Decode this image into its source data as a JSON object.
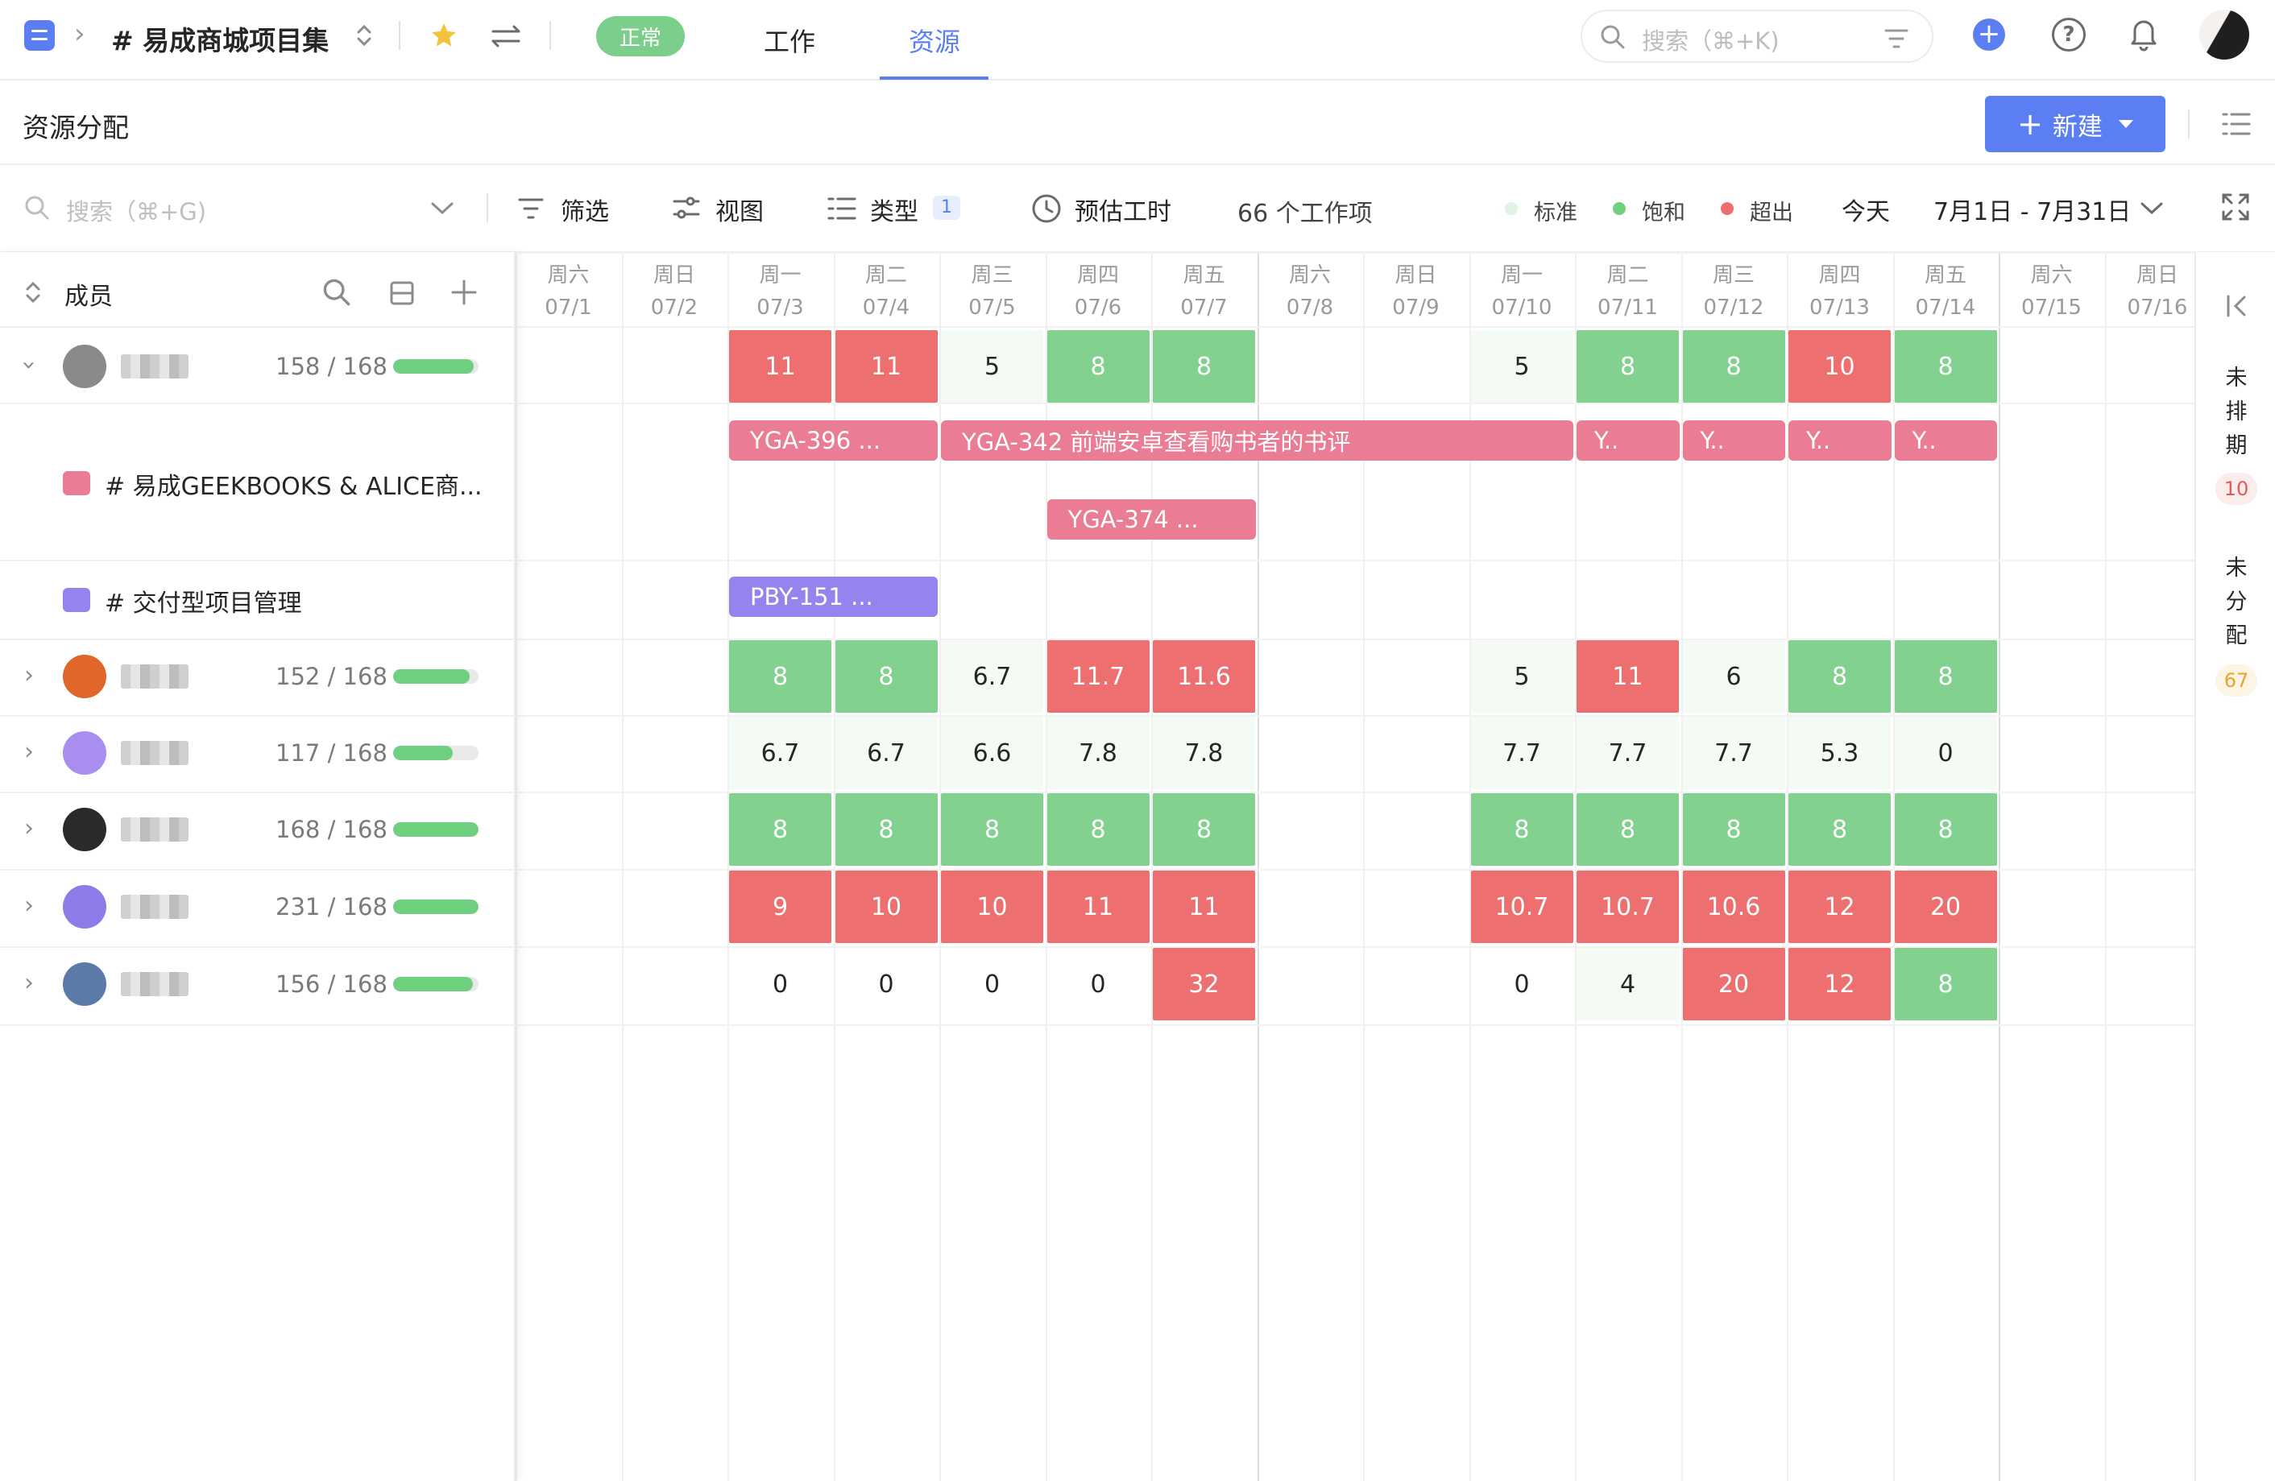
{
  "topbar": {
    "project_title": "# 易成商城项目集",
    "status_pill": "正常",
    "tabs": [
      {
        "label": "工作",
        "active": false
      },
      {
        "label": "资源",
        "active": true
      }
    ],
    "search_placeholder": "搜索（⌘+K)"
  },
  "header": {
    "title": "资源分配",
    "new_button": "新建"
  },
  "toolbar": {
    "search_placeholder": "搜索（⌘+G)",
    "filter_label": "筛选",
    "view_label": "视图",
    "type_label": "类型",
    "type_count": "1",
    "estimate_label": "预估工时",
    "items_count": "66 个工作项",
    "legend": [
      {
        "label": "标准",
        "color": "#e6f6e8"
      },
      {
        "label": "饱和",
        "color": "#6fd080"
      },
      {
        "label": "超出",
        "color": "#ed6f6f"
      }
    ],
    "today_label": "今天",
    "date_range": "7月1日 - 7月31日"
  },
  "left_panel": {
    "column_title": "成员"
  },
  "days": [
    {
      "weekday": "周六",
      "date": "07/1"
    },
    {
      "weekday": "周日",
      "date": "07/2"
    },
    {
      "weekday": "周一",
      "date": "07/3"
    },
    {
      "weekday": "周二",
      "date": "07/4"
    },
    {
      "weekday": "周三",
      "date": "07/5"
    },
    {
      "weekday": "周四",
      "date": "07/6"
    },
    {
      "weekday": "周五",
      "date": "07/7"
    },
    {
      "weekday": "周六",
      "date": "07/8"
    },
    {
      "weekday": "周日",
      "date": "07/9"
    },
    {
      "weekday": "周一",
      "date": "07/10"
    },
    {
      "weekday": "周二",
      "date": "07/11"
    },
    {
      "weekday": "周三",
      "date": "07/12"
    },
    {
      "weekday": "周四",
      "date": "07/13"
    },
    {
      "weekday": "周五",
      "date": "07/14"
    },
    {
      "weekday": "周六",
      "date": "07/15"
    },
    {
      "weekday": "周日",
      "date": "07/16"
    }
  ],
  "members": [
    {
      "hours": "158 / 168",
      "usage": 0.94,
      "avatar_color": "#8a8a8a",
      "expanded": true,
      "cells": [
        [
          2,
          "11",
          "over"
        ],
        [
          3,
          "11",
          "over"
        ],
        [
          4,
          "5",
          "std"
        ],
        [
          5,
          "8",
          "full"
        ],
        [
          6,
          "8",
          "full"
        ],
        [
          9,
          "5",
          "std"
        ],
        [
          10,
          "8",
          "full"
        ],
        [
          11,
          "8",
          "full"
        ],
        [
          12,
          "10",
          "over"
        ],
        [
          13,
          "8",
          "full"
        ]
      ]
    },
    {
      "hours": "152 / 168",
      "usage": 0.9,
      "avatar_color": "#e0662a",
      "expanded": false,
      "cells": [
        [
          2,
          "8",
          "full"
        ],
        [
          3,
          "8",
          "full"
        ],
        [
          4,
          "6.7",
          "std"
        ],
        [
          5,
          "11.7",
          "over"
        ],
        [
          6,
          "11.6",
          "over"
        ],
        [
          9,
          "5",
          "std"
        ],
        [
          10,
          "11",
          "over"
        ],
        [
          11,
          "6",
          "std"
        ],
        [
          12,
          "8",
          "full"
        ],
        [
          13,
          "8",
          "full"
        ]
      ]
    },
    {
      "hours": "117 / 168",
      "usage": 0.7,
      "avatar_color": "#a98ef0",
      "expanded": false,
      "cells": [
        [
          2,
          "6.7",
          "std"
        ],
        [
          3,
          "6.7",
          "std"
        ],
        [
          4,
          "6.6",
          "std"
        ],
        [
          5,
          "7.8",
          "std"
        ],
        [
          6,
          "7.8",
          "std"
        ],
        [
          9,
          "7.7",
          "std"
        ],
        [
          10,
          "7.7",
          "std"
        ],
        [
          11,
          "7.7",
          "std"
        ],
        [
          12,
          "5.3",
          "std"
        ],
        [
          13,
          "0",
          "std"
        ]
      ]
    },
    {
      "hours": "168 / 168",
      "usage": 1.0,
      "avatar_color": "#2a2a2a",
      "expanded": false,
      "cells": [
        [
          2,
          "8",
          "full"
        ],
        [
          3,
          "8",
          "full"
        ],
        [
          4,
          "8",
          "full"
        ],
        [
          5,
          "8",
          "full"
        ],
        [
          6,
          "8",
          "full"
        ],
        [
          9,
          "8",
          "full"
        ],
        [
          10,
          "8",
          "full"
        ],
        [
          11,
          "8",
          "full"
        ],
        [
          12,
          "8",
          "full"
        ],
        [
          13,
          "8",
          "full"
        ]
      ]
    },
    {
      "hours": "231 / 168",
      "usage": 1.0,
      "avatar_color": "#8f7be8",
      "expanded": false,
      "cells": [
        [
          2,
          "9",
          "over"
        ],
        [
          3,
          "10",
          "over"
        ],
        [
          4,
          "10",
          "over"
        ],
        [
          5,
          "11",
          "over"
        ],
        [
          6,
          "11",
          "over"
        ],
        [
          9,
          "10.7",
          "over"
        ],
        [
          10,
          "10.7",
          "over"
        ],
        [
          11,
          "10.6",
          "over"
        ],
        [
          12,
          "12",
          "over"
        ],
        [
          13,
          "20",
          "over"
        ]
      ]
    },
    {
      "hours": "156 / 168",
      "usage": 0.93,
      "avatar_color": "#5b7aa8",
      "expanded": false,
      "cells": [
        [
          2,
          "0",
          "empty"
        ],
        [
          3,
          "0",
          "empty"
        ],
        [
          4,
          "0",
          "empty"
        ],
        [
          5,
          "0",
          "empty"
        ],
        [
          6,
          "32",
          "over"
        ],
        [
          9,
          "0",
          "empty"
        ],
        [
          10,
          "4",
          "std"
        ],
        [
          11,
          "20",
          "over"
        ],
        [
          12,
          "12",
          "over"
        ],
        [
          13,
          "8",
          "full"
        ]
      ]
    }
  ],
  "projects": [
    {
      "name": "# 易成GEEKBOOKS & ALICE商...",
      "color": "#ea7c94"
    },
    {
      "name": "# 交付型项目管理",
      "color": "#9683ee"
    }
  ],
  "tasks": [
    {
      "label": "YGA-396 ...",
      "start": 2,
      "span": 2,
      "lane": 0,
      "color": "pink"
    },
    {
      "label": "YGA-342  前端安卓查看购书者的书评",
      "start": 4,
      "span": 6,
      "lane": 0,
      "color": "pink"
    },
    {
      "label": "Y..",
      "start": 10,
      "span": 1,
      "lane": 0,
      "color": "pink"
    },
    {
      "label": "Y..",
      "start": 11,
      "span": 1,
      "lane": 0,
      "color": "pink"
    },
    {
      "label": "Y..",
      "start": 12,
      "span": 1,
      "lane": 0,
      "color": "pink"
    },
    {
      "label": "Y..",
      "start": 13,
      "span": 1,
      "lane": 0,
      "color": "pink"
    },
    {
      "label": "YGA-374 ...",
      "start": 5,
      "span": 2,
      "lane": 1,
      "color": "pink"
    },
    {
      "label": "PBY-151  ...",
      "start": 2,
      "span": 2,
      "lane": 2,
      "color": "purple"
    }
  ],
  "right_strip": {
    "unscheduled_label": [
      "未",
      "排",
      "期"
    ],
    "unscheduled_count": "10",
    "unassigned_label": [
      "未",
      "分",
      "配"
    ],
    "unassigned_count": "67"
  }
}
